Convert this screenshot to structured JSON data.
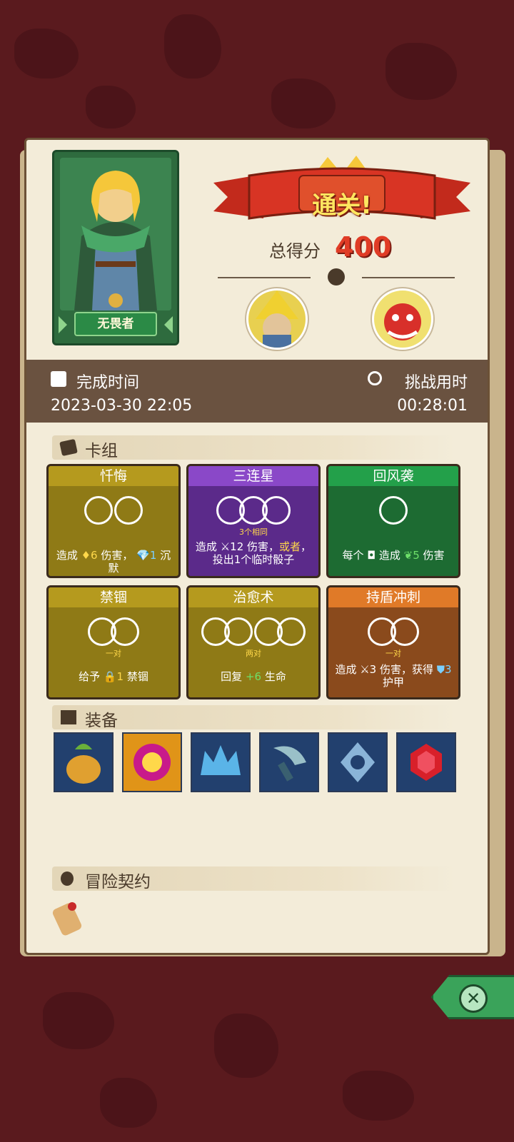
{
  "hero": {
    "name": "无畏者"
  },
  "result": {
    "banner": "通关!",
    "score_label": "总得分",
    "score_value": "400"
  },
  "times": {
    "finish_label": "完成时间",
    "finish_value": "2023-03-30 22:05",
    "duration_label": "挑战用时",
    "duration_value": "00:28:01"
  },
  "deck": {
    "title": "卡组",
    "cards": [
      {
        "name": "忏悔",
        "color": "#8f7a16",
        "title_color": "#b59a1e",
        "slot_label": "",
        "desc_parts": [
          "造成 ",
          "♦6",
          " 伤害， ",
          "💎1",
          " 沉默"
        ]
      },
      {
        "name": "三连星",
        "color": "#5b2a8a",
        "title_color": "#8a48c8",
        "slot_label": "3个相同",
        "desc_parts": [
          "造成 ",
          "⚔12",
          " 伤害，",
          "或者",
          "，投出1个临时骰子"
        ]
      },
      {
        "name": "回风袭",
        "color": "#1d6b32",
        "title_color": "#23a04a",
        "slot_label": "",
        "desc_parts": [
          "每个 ",
          "◘",
          " 造成 ",
          "❦5",
          " 伤害"
        ]
      },
      {
        "name": "禁锢",
        "color": "#8f7a16",
        "title_color": "#b59a1e",
        "slot_label": "一对",
        "desc_parts": [
          "给予 ",
          "🔒1",
          " 禁锢"
        ]
      },
      {
        "name": "治愈术",
        "color": "#8f7a16",
        "title_color": "#b59a1e",
        "slot_label": "两对",
        "desc_parts": [
          "回复 ",
          "+6",
          " 生命"
        ]
      },
      {
        "name": "持盾冲刺",
        "color": "#8a4a1c",
        "title_color": "#e07a28",
        "slot_label": "一对",
        "desc_parts": [
          "造成 ",
          "⚔3",
          " 伤害，获得 ",
          "⛊3",
          " 护甲"
        ]
      }
    ]
  },
  "equipment": {
    "title": "装备",
    "items": [
      {
        "name": "golden-pot-icon",
        "bg": "#22406e"
      },
      {
        "name": "magic-orb-icon",
        "bg": "#e09418"
      },
      {
        "name": "crown-icon",
        "bg": "#22406e"
      },
      {
        "name": "scythe-icon",
        "bg": "#22406e"
      },
      {
        "name": "snowflake-rune-icon",
        "bg": "#22406e"
      },
      {
        "name": "ruby-gem-icon",
        "bg": "#22406e"
      }
    ]
  },
  "contract": {
    "title": "冒险契约"
  }
}
